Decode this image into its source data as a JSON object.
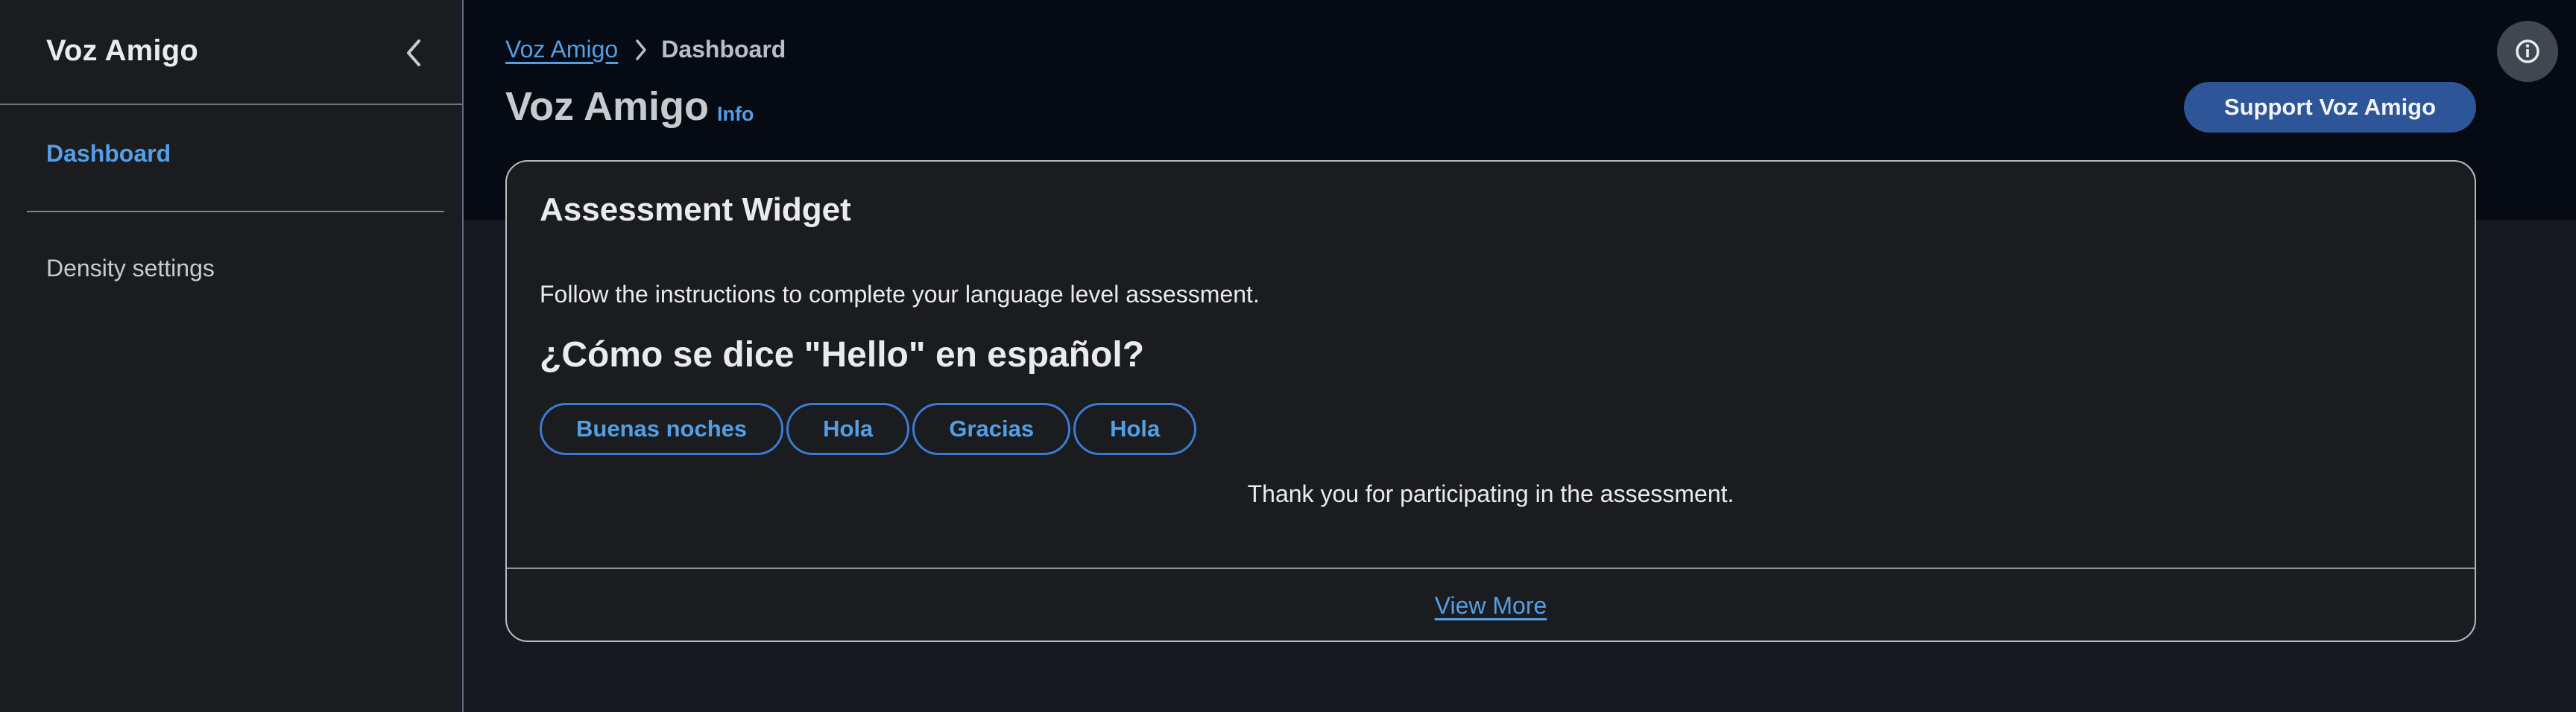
{
  "sidebar": {
    "title": "Voz Amigo",
    "collapse_icon": "chevron-left-icon",
    "items": [
      {
        "label": "Dashboard",
        "active": true
      },
      {
        "label": "Density settings",
        "active": false
      }
    ]
  },
  "header": {
    "breadcrumb": [
      {
        "label": "Voz Amigo",
        "link": true
      },
      {
        "label": "Dashboard",
        "link": false
      }
    ],
    "title": "Voz Amigo",
    "info_label": "Info",
    "support_button": "Support Voz Amigo",
    "info_panel_icon": "info-circle-icon"
  },
  "widget": {
    "title": "Assessment Widget",
    "description": "Follow the instructions to complete your language level assessment.",
    "question": "¿Cómo se dice \"Hello\" en español?",
    "options": [
      "Buenas noches",
      "Hola",
      "Gracias",
      "Hola"
    ],
    "thanks": "Thank you for participating in the assessment.",
    "view_more": "View More"
  },
  "colors": {
    "accent": "#539fe5",
    "button_primary": "#2d5597",
    "header_bg": "#050a13",
    "page_bg": "#16191f",
    "panel_bg": "#1b1c1f"
  }
}
